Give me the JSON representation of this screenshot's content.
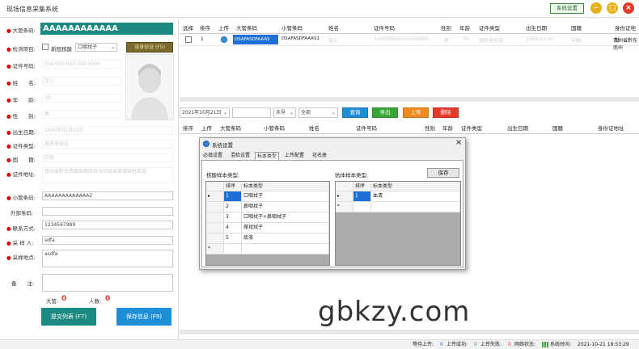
{
  "app": {
    "title": "现场信息采集系统",
    "settings_btn": "系统设置"
  },
  "left": {
    "big_barcode_label": "大管条码:",
    "big_barcode": "AAAAAAAAAAAA",
    "check_item_label": "检测项目:",
    "check_checkbox": "新冠核酸",
    "check_select": "口咽拭子",
    "read_card": "读身份证 (F5)",
    "id_label": "证件号码:",
    "id_value": "330 000 000 000 0000",
    "name_label": "姓　　名:",
    "name_value": "张三",
    "age_label": "年　　龄:",
    "age_value": "30",
    "gender_label": "性　　别:",
    "gender_value": "男",
    "birth_label": "出生日期:",
    "birth_value": "1990年01月01日",
    "idtype_label": "证件类型:",
    "idtype_value": "居民身份证",
    "nation_label": "国　　籍:",
    "nation_value": "中国",
    "address_label": "证件地址:",
    "address_value": "贵州省黔东南苗族侗族自治州某县某镇某村某组",
    "small_label": "小管条码:",
    "small_value": "AAAAAAAAAAAAA2",
    "ext_label": "外部条码:",
    "ext_value": "",
    "phone_label": "联系方式:",
    "phone_value": "1234567989",
    "collector_label": "采 样 人:",
    "collector_value": "sdfa",
    "place_label": "采样地点:",
    "place_value": "asdfa",
    "remark_label": "备　　注:",
    "remark_value": "",
    "bigtube_label": "大管:",
    "bigtube_count": "0",
    "people_label": "人数:",
    "people_count": "0",
    "submit_btn": "提交列表 (F7)",
    "save_btn": "保存信息 (F9)"
  },
  "top_table": {
    "headers": [
      "选择",
      "排序",
      "上传",
      "大管条码",
      "小管条码",
      "姓名",
      "证件号码",
      "性别",
      "年龄",
      "证件类型",
      "出生日期",
      "国籍",
      "身份证地址"
    ],
    "row": {
      "seq": "1",
      "big": "DSAFASDFAAAS",
      "small": "DSAFASDFAAAS1",
      "name": "张三",
      "id": "330000000000000000",
      "gender": "男",
      "age": "30",
      "idtype": "居民身份证",
      "birth": "1990-01-01",
      "nation": "中国",
      "addr": "贵州省黔东南州"
    }
  },
  "toolbar": {
    "date": "2021年10月21日",
    "status": "未导",
    "type": "全部",
    "query": "查询",
    "export": "导出",
    "upload": "上传",
    "delete": "删除"
  },
  "bottom_table": {
    "headers": [
      "排序",
      "上传",
      "大管条码",
      "小管条码",
      "姓名",
      "证件号码",
      "性别",
      "年龄",
      "证件类型",
      "出生日期",
      "国籍",
      "身份证地址"
    ]
  },
  "dialog": {
    "title": "系统设置",
    "tabs": [
      "必填设置",
      "混检设置",
      "标本类型",
      "上传配置",
      "花名册"
    ],
    "left_label": "核酸样本类型:",
    "right_label": "抗体样本类型:",
    "save": "保存",
    "col_seq": "排序",
    "col_type": "标本类型",
    "left_rows": [
      {
        "seq": "1",
        "type": "口咽拭子"
      },
      {
        "seq": "2",
        "type": "鼻咽拭子"
      },
      {
        "seq": "3",
        "type": "口咽拭子+鼻咽拭子"
      },
      {
        "seq": "4",
        "type": "撑拭拭子"
      },
      {
        "seq": "5",
        "type": "痰液"
      }
    ],
    "right_rows": [
      {
        "seq": "1",
        "type": "血清"
      }
    ]
  },
  "status": {
    "wait_label": "等待上传:",
    "wait": "0",
    "ok_label": "上传成功:",
    "ok": "0",
    "fail_label": "上传失败:",
    "fail": "0",
    "net_label": "网络状态:",
    "time_label": "系统时间:",
    "time": "2021-10-21 18:53:29"
  },
  "watermark": "gbkzy.com",
  "colors": {
    "teal": "#1c8a80",
    "blue": "#1e8fd6",
    "green": "#3aa635",
    "orange": "#f08a1e",
    "red": "#e53a2a"
  }
}
